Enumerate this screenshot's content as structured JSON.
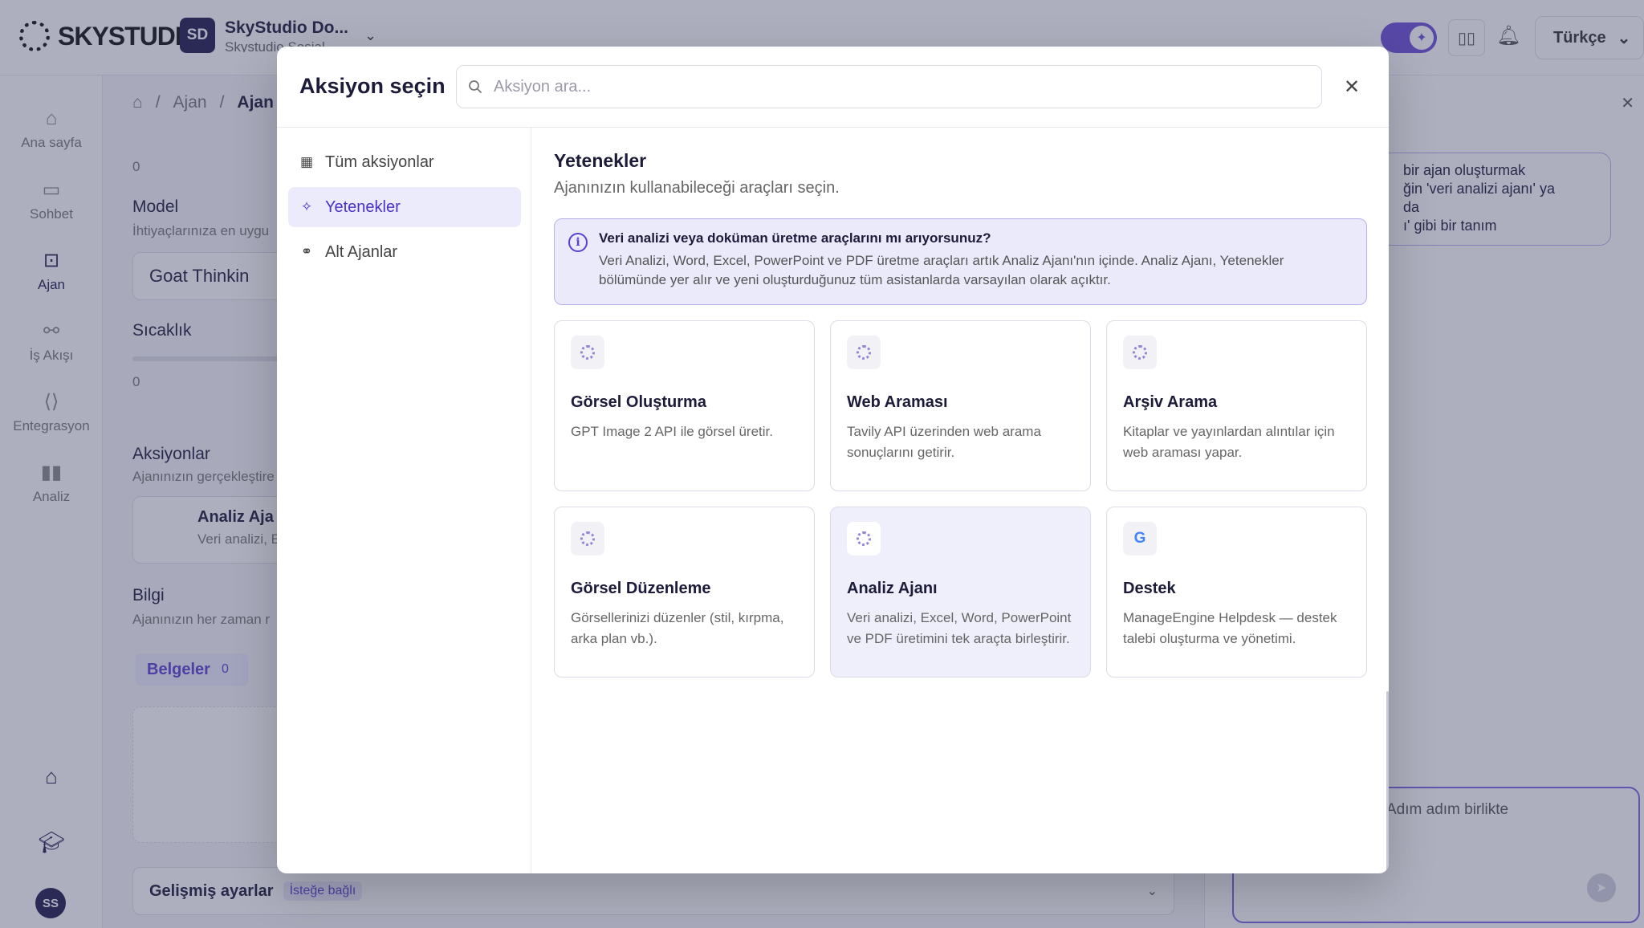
{
  "app": {
    "logo_text": "SKYSTUDIO",
    "workspace": {
      "initials": "SD",
      "name": "SkyStudio Do...",
      "sub": "Skystudio Sosial"
    },
    "language": "Türkçe"
  },
  "sidebar": {
    "items": [
      {
        "label": "Ana sayfa",
        "icon": "home-icon"
      },
      {
        "label": "Sohbet",
        "icon": "chat-icon"
      },
      {
        "label": "Ajan",
        "icon": "robot-icon"
      },
      {
        "label": "İş Akışı",
        "icon": "workflow-icon"
      },
      {
        "label": "Entegrasyon",
        "icon": "code-icon"
      },
      {
        "label": "Analiz",
        "icon": "chart-icon"
      }
    ],
    "avatar": "SS"
  },
  "background": {
    "breadcrumb": [
      "Ajan",
      "Ajan"
    ],
    "counter_a": "0",
    "model_label": "Model",
    "model_sub": "İhtiyaçlarınıza en uygu",
    "model_value": "Goat Thinkin",
    "temperature_label": "Sıcaklık",
    "counter_b": "0",
    "actions_label": "Aksiyonlar",
    "actions_sub": "Ajanınızın gerçekleştire",
    "action_item_title": "Analiz Aja",
    "action_item_sub": "Veri analizi, E",
    "info_label": "Bilgi",
    "info_sub": "Ajanınızın her zaman r",
    "docs_tab": "Belgeler",
    "docs_count": "0",
    "advanced_title": "Gelişmiş ayarlar",
    "advanced_badge": "İsteğe bağlı",
    "chat_bubble_lines": [
      "bir ajan oluşturmak",
      "ğin 'veri analizi ajanı' ya da",
      "ı' gibi bir tanım"
    ],
    "chat_input_text": "Adım adım birlikte"
  },
  "modal": {
    "title": "Aksiyon seçin",
    "search_placeholder": "Aksiyon ara...",
    "nav": [
      {
        "label": "Tüm aksiyonlar",
        "icon": "grid-icon"
      },
      {
        "label": "Yetenekler",
        "icon": "sparkle-icon",
        "active": true
      },
      {
        "label": "Alt Ajanlar",
        "icon": "subagent-icon"
      }
    ],
    "section_title": "Yetenekler",
    "section_sub": "Ajanınızın kullanabileceği araçları seçin.",
    "info_title": "Veri analizi veya doküman üretme araçlarını mı arıyorsunuz?",
    "info_text": "Veri Analizi, Word, Excel, PowerPoint ve PDF üretme araçları artık Analiz Ajanı'nın içinde. Analiz Ajanı, Yetenekler bölümünde yer alır ve yeni oluşturduğunuz tüm asistanlarda varsayılan olarak açıktır.",
    "cards": [
      {
        "title": "Görsel Oluşturma",
        "desc": "GPT Image 2 API ile görsel üretir.",
        "icon": "spinner-icon"
      },
      {
        "title": "Web Araması",
        "desc": "Tavily API üzerinden web arama sonuçlarını getirir.",
        "icon": "spinner-icon"
      },
      {
        "title": "Arşiv Arama",
        "desc": "Kitaplar ve yayınlardan alıntılar için web araması yapar.",
        "icon": "spinner-icon"
      },
      {
        "title": "Görsel Düzenleme",
        "desc": "Görsellerinizi düzenler (stil, kırpma, arka plan vb.).",
        "icon": "spinner-icon"
      },
      {
        "title": "Analiz Ajanı",
        "desc": "Veri analizi, Excel, Word, PowerPoint ve PDF üretimini tek araçta birleştirir.",
        "icon": "spinner-icon",
        "highlighted": true
      },
      {
        "title": "Destek",
        "desc": "ManageEngine Helpdesk — destek talebi oluşturma ve yönetimi.",
        "icon": "google-icon",
        "icon_glyph": "G"
      }
    ]
  }
}
